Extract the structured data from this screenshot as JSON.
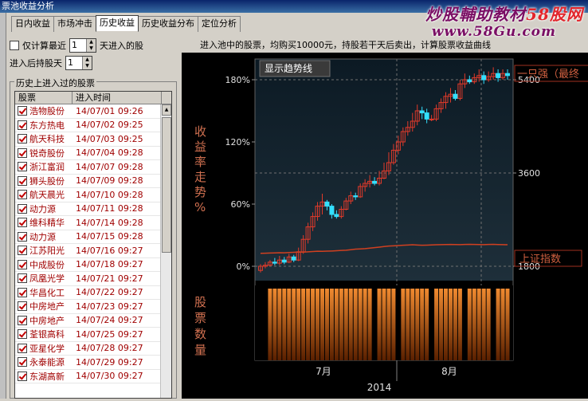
{
  "window": {
    "title": "票池收益分析"
  },
  "watermark": {
    "brand_main": "炒股輔助教材",
    "brand_red": "58股网",
    "url": "www.58Gu.com"
  },
  "tabs": [
    {
      "label": "日内收益"
    },
    {
      "label": "市场冲击"
    },
    {
      "label": "历史收益"
    },
    {
      "label": "历史收益分布"
    },
    {
      "label": "定位分析"
    }
  ],
  "options": {
    "only_recent_label": "仅计算最近",
    "only_recent_value": "1",
    "days_suffix": "天进入的股",
    "hold_label": "进入后持股天",
    "hold_value": "1"
  },
  "note": "进入池中的股票，均购买10000元，持股若干天后卖出，计算股票收益曲线",
  "history": {
    "group_label": "历史上进入过的股票",
    "col_stock": "股票",
    "col_time": "进入时间",
    "rows": [
      {
        "name": "浩物股份",
        "time": "14/07/01 09:26"
      },
      {
        "name": "东方热电",
        "time": "14/07/02 09:25"
      },
      {
        "name": "航天科技",
        "time": "14/07/03 09:25"
      },
      {
        "name": "锐奇股份",
        "time": "14/07/04 09:28"
      },
      {
        "name": "浙江富润",
        "time": "14/07/07 09:28"
      },
      {
        "name": "狮头股份",
        "time": "14/07/09 09:28"
      },
      {
        "name": "航天晨光",
        "time": "14/07/10 09:28"
      },
      {
        "name": "动力源",
        "time": "14/07/11 09:28"
      },
      {
        "name": "维科精华",
        "time": "14/07/14 09:28"
      },
      {
        "name": "动力源",
        "time": "14/07/15 09:28"
      },
      {
        "name": "江苏阳光",
        "time": "14/07/16 09:27"
      },
      {
        "name": "中成股份",
        "time": "14/07/18 09:27"
      },
      {
        "name": "凤凰光学",
        "time": "14/07/21 09:27"
      },
      {
        "name": "华昌化工",
        "time": "14/07/22 09:27"
      },
      {
        "name": "中房地产",
        "time": "14/07/23 09:27"
      },
      {
        "name": "中房地产",
        "time": "14/07/24 09:27"
      },
      {
        "name": "荃银高科",
        "time": "14/07/25 09:27"
      },
      {
        "name": "亚星化学",
        "time": "14/07/28 09:27"
      },
      {
        "name": "永泰能源",
        "time": "14/07/29 09:27"
      },
      {
        "name": "东湖高新",
        "time": "14/07/30 09:27"
      }
    ]
  },
  "chart": {
    "trend_button": "显示趋势线",
    "left_label": "收益率走势%",
    "bottom_left_label": "股票数量",
    "right_top_label": "一只强（最终",
    "right_index_label": "上证指数",
    "colors": {
      "up": "#e23a2a",
      "down": "#33e0ff",
      "index": "#d04020",
      "bars": "#e06a14",
      "axis": "#d07050"
    }
  },
  "chart_data": {
    "type": "candlestick",
    "left_axis": {
      "unit": "%",
      "ticks": [
        0,
        60,
        120,
        180
      ],
      "tick_labels": [
        "0%",
        "60%",
        "120%",
        "180%"
      ]
    },
    "right_axis": {
      "ticks": [
        1800,
        3600,
        5400
      ],
      "tick_labels": [
        "1800",
        "3600",
        "5400"
      ]
    },
    "x_axis": {
      "tick_labels": [
        "7月",
        "8月"
      ],
      "year_label": "2014"
    },
    "candles": [
      {
        "open": -4,
        "close": 0,
        "low": -6,
        "high": 2
      },
      {
        "open": 0,
        "close": 1,
        "low": -2,
        "high": 4
      },
      {
        "open": 1,
        "close": 4,
        "low": 0,
        "high": 6
      },
      {
        "open": 4,
        "close": 3,
        "low": 1,
        "high": 8
      },
      {
        "open": 3,
        "close": 6,
        "low": 1,
        "high": 10
      },
      {
        "open": 6,
        "close": 4,
        "low": 2,
        "high": 9
      },
      {
        "open": 4,
        "close": 9,
        "low": 3,
        "high": 12
      },
      {
        "open": 9,
        "close": 6,
        "low": 4,
        "high": 11
      },
      {
        "open": 6,
        "close": 14,
        "low": 5,
        "high": 18
      },
      {
        "open": 14,
        "close": 26,
        "low": 12,
        "high": 30
      },
      {
        "open": 26,
        "close": 38,
        "low": 22,
        "high": 42
      },
      {
        "open": 38,
        "close": 48,
        "low": 34,
        "high": 52
      },
      {
        "open": 48,
        "close": 58,
        "low": 44,
        "high": 62
      },
      {
        "open": 58,
        "close": 62,
        "low": 50,
        "high": 70
      },
      {
        "open": 62,
        "close": 58,
        "low": 54,
        "high": 64
      },
      {
        "open": 58,
        "close": 50,
        "low": 46,
        "high": 60
      },
      {
        "open": 50,
        "close": 48,
        "low": 46,
        "high": 54
      },
      {
        "open": 48,
        "close": 55,
        "low": 46,
        "high": 58
      },
      {
        "open": 55,
        "close": 63,
        "low": 54,
        "high": 66
      },
      {
        "open": 63,
        "close": 68,
        "low": 60,
        "high": 72
      },
      {
        "open": 68,
        "close": 67,
        "low": 64,
        "high": 71
      },
      {
        "open": 67,
        "close": 77,
        "low": 66,
        "high": 80
      },
      {
        "open": 77,
        "close": 80,
        "low": 72,
        "high": 84
      },
      {
        "open": 80,
        "close": 82,
        "low": 76,
        "high": 88
      },
      {
        "open": 82,
        "close": 80,
        "low": 78,
        "high": 86
      },
      {
        "open": 80,
        "close": 85,
        "low": 78,
        "high": 92
      },
      {
        "open": 85,
        "close": 92,
        "low": 84,
        "high": 100
      },
      {
        "open": 92,
        "close": 100,
        "low": 88,
        "high": 110
      },
      {
        "open": 100,
        "close": 112,
        "low": 98,
        "high": 118
      },
      {
        "open": 112,
        "close": 120,
        "low": 108,
        "high": 126
      },
      {
        "open": 120,
        "close": 130,
        "low": 116,
        "high": 134
      },
      {
        "open": 130,
        "close": 134,
        "low": 126,
        "high": 140
      },
      {
        "open": 134,
        "close": 140,
        "low": 130,
        "high": 148
      },
      {
        "open": 140,
        "close": 150,
        "low": 136,
        "high": 156
      },
      {
        "open": 150,
        "close": 148,
        "low": 142,
        "high": 154
      },
      {
        "open": 148,
        "close": 142,
        "low": 138,
        "high": 152
      },
      {
        "open": 142,
        "close": 142,
        "low": 140,
        "high": 146
      },
      {
        "open": 142,
        "close": 152,
        "low": 140,
        "high": 156
      },
      {
        "open": 152,
        "close": 158,
        "low": 148,
        "high": 162
      },
      {
        "open": 158,
        "close": 164,
        "low": 152,
        "high": 168
      },
      {
        "open": 164,
        "close": 166,
        "low": 158,
        "high": 172
      },
      {
        "open": 166,
        "close": 162,
        "low": 160,
        "high": 170
      },
      {
        "open": 162,
        "close": 176,
        "low": 160,
        "high": 180
      },
      {
        "open": 176,
        "close": 180,
        "low": 172,
        "high": 186
      },
      {
        "open": 180,
        "close": 178,
        "low": 176,
        "high": 184
      },
      {
        "open": 178,
        "close": 182,
        "low": 176,
        "high": 186
      },
      {
        "open": 182,
        "close": 184,
        "low": 178,
        "high": 190
      },
      {
        "open": 184,
        "close": 180,
        "low": 176,
        "high": 188
      },
      {
        "open": 180,
        "close": 183,
        "low": 178,
        "high": 188
      },
      {
        "open": 183,
        "close": 186,
        "low": 180,
        "high": 192
      },
      {
        "open": 186,
        "close": 182,
        "low": 178,
        "high": 190
      },
      {
        "open": 182,
        "close": 186,
        "low": 180,
        "high": 190
      },
      {
        "open": 186,
        "close": 184,
        "low": 180,
        "high": 190
      }
    ],
    "index_line": [
      2050,
      2052,
      2055,
      2058,
      2062,
      2060,
      2065,
      2070,
      2075,
      2072,
      2078,
      2085,
      2090,
      2088,
      2092,
      2095,
      2100,
      2105,
      2110,
      2120,
      2130,
      2135,
      2140,
      2150,
      2160,
      2170,
      2180,
      2190,
      2195,
      2200,
      2205,
      2210,
      2215,
      2210,
      2205,
      2208,
      2212,
      2215,
      2218,
      2220,
      2222,
      2220,
      2218,
      2221,
      2224,
      2222,
      2220,
      2218,
      2221,
      2223,
      2220,
      2218,
      2216
    ],
    "stock_count": [
      0,
      0,
      1,
      1,
      1,
      1,
      1,
      1,
      1,
      1,
      1,
      1,
      1,
      1,
      1,
      1,
      1,
      1,
      1,
      1,
      1,
      1,
      1,
      1,
      0,
      1,
      1,
      1,
      1,
      0,
      1,
      1,
      1,
      1,
      1,
      1,
      0,
      1,
      1,
      1,
      1,
      1,
      1,
      0,
      1,
      1,
      1,
      1,
      1,
      0,
      1,
      1,
      1
    ]
  }
}
